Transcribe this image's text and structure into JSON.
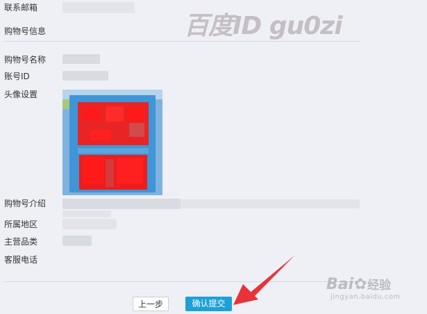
{
  "watermark_text": "百度ID gu0zi",
  "form": {
    "email_label": "联系邮箱",
    "section_title": "购物号信息",
    "name_label": "购物号名称",
    "id_label": "账号ID",
    "avatar_label": "头像设置",
    "intro_label": "购物号介绍",
    "region_label": "所属地区",
    "category_label": "主营品类",
    "phone_label": "客服电话"
  },
  "buttons": {
    "prev_label": "上一步",
    "confirm_label": "确认提交"
  },
  "baidu_watermark": {
    "brand": "Bai",
    "brand_suffix": "经验",
    "url": "jingyan.baidu.com"
  },
  "colors": {
    "background": "#eef0f5",
    "confirm_button": "#1ea0d7",
    "arrow": "#e8333a",
    "avatar_blue": "#3f95d6",
    "avatar_red": "#ff1a1a"
  },
  "icons": {
    "pointer": "red-arrow-icon",
    "avatar": "blurred-avatar-image",
    "paw": "baidu-paw-icon"
  }
}
